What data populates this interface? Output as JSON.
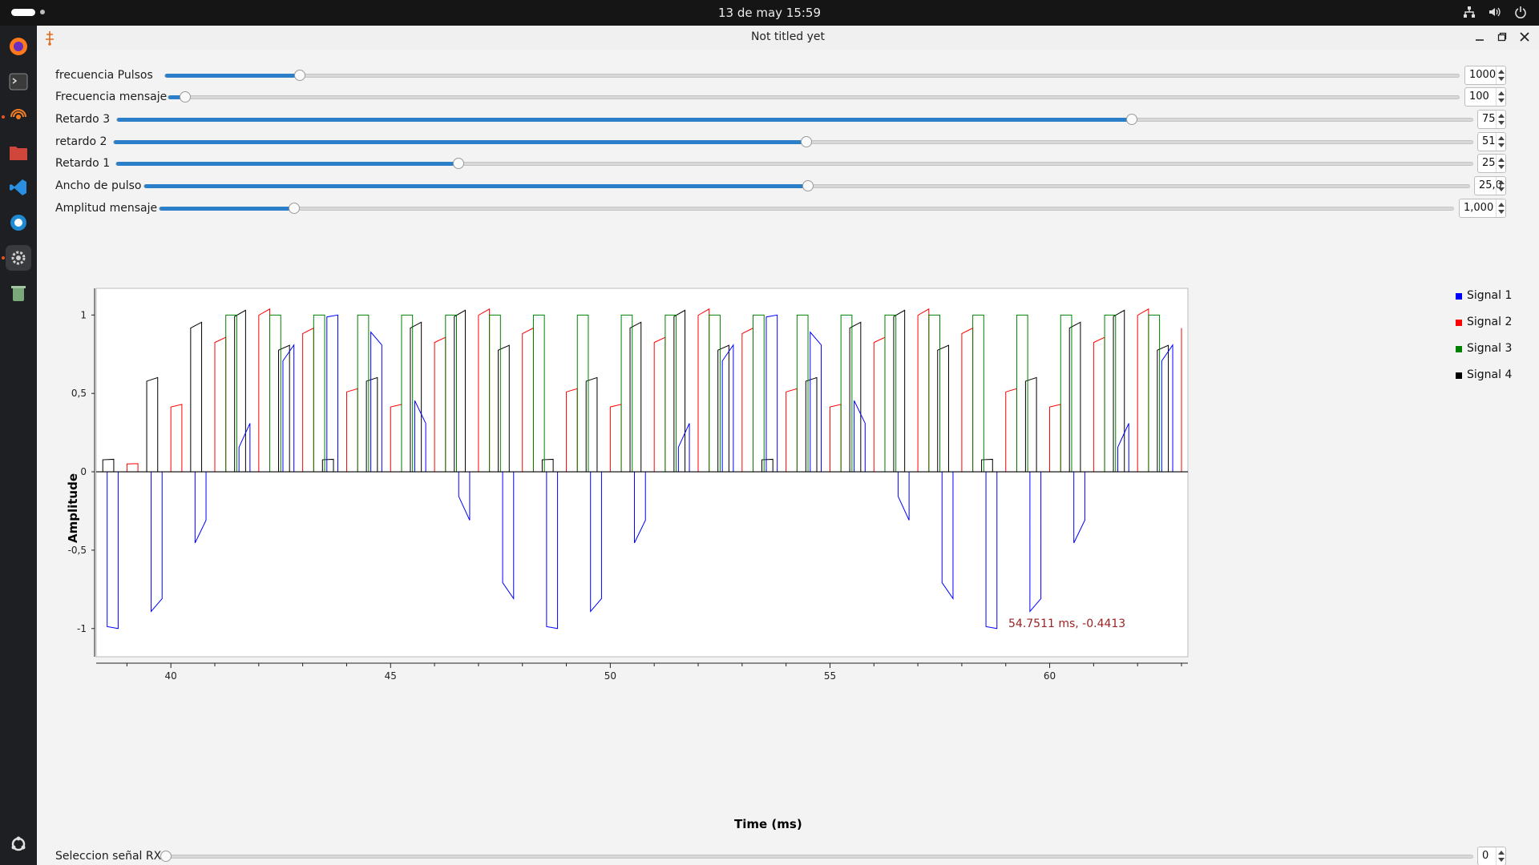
{
  "topbar": {
    "clock": "13 de may  15:59"
  },
  "window": {
    "title": "Not titled yet"
  },
  "sliders": [
    {
      "label": "frecuencia Pulsos",
      "value": "1000",
      "fraction": 0.104
    },
    {
      "label": "Frecuencia mensaje",
      "value": "100",
      "fraction": 0.013
    },
    {
      "label": "Retardo 3",
      "value": "75",
      "fraction": 0.748
    },
    {
      "label": "retardo 2",
      "value": "51",
      "fraction": 0.509
    },
    {
      "label": "Retardo 1",
      "value": "25",
      "fraction": 0.252
    },
    {
      "label": "Ancho de pulso",
      "value": "25,0",
      "fraction": 0.5
    },
    {
      "label": "Amplitud mensaje",
      "value": "1,000",
      "fraction": 0.104
    }
  ],
  "bottom_slider": {
    "label": "Seleccion señal RX",
    "value": "0",
    "fraction": 0
  },
  "plot": {
    "cursor_readout": "54.7511 ms, -0.4413"
  },
  "chart_data": {
    "type": "line",
    "xlabel": "Time (ms)",
    "ylabel": "Amplitude",
    "xlim": [
      38.3,
      63.0
    ],
    "ylim": [
      -1.18,
      1.16
    ],
    "xticks": [
      "40",
      "45",
      "50",
      "55",
      "60"
    ],
    "xtick_values": [
      40,
      45,
      50,
      55,
      60
    ],
    "yticks": [
      "1",
      "0,5",
      "0",
      "-0,5",
      "-1"
    ],
    "ytick_values": [
      1,
      0.5,
      0,
      -0.5,
      -1
    ],
    "grid": false,
    "legend_position": "right",
    "series": [
      {
        "name": "Signal 1",
        "color": "#0000ff"
      },
      {
        "name": "Signal 2",
        "color": "#ff0000"
      },
      {
        "name": "Signal 3",
        "color": "#008000"
      },
      {
        "name": "Signal 4",
        "color": "#000000"
      }
    ]
  }
}
